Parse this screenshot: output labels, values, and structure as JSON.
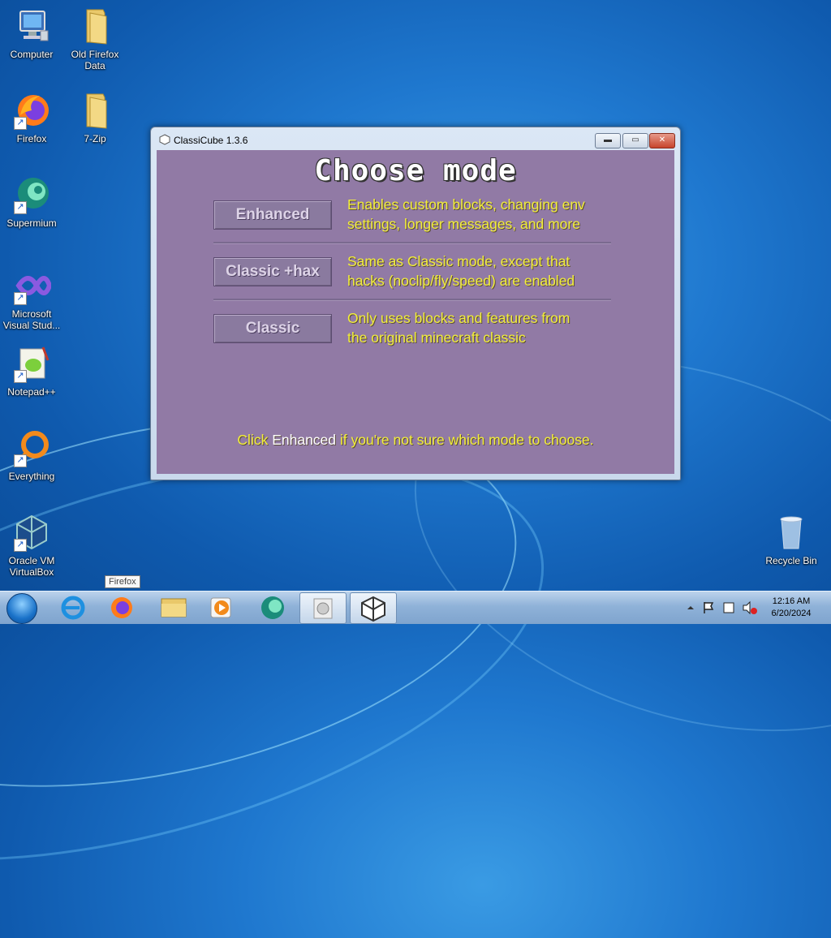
{
  "desktop": {
    "icons": [
      {
        "label": "Computer",
        "icon": "computer-icon"
      },
      {
        "label": "Old Firefox Data",
        "icon": "folder-icon"
      },
      {
        "label": "Firefox",
        "icon": "firefox-icon"
      },
      {
        "label": "7-Zip",
        "icon": "folder-icon"
      },
      {
        "label": "Supermium",
        "icon": "supermium-icon"
      },
      {
        "label": "Microsoft Visual Stud...",
        "icon": "visual-studio-icon"
      },
      {
        "label": "Notepad++",
        "icon": "notepadpp-icon"
      },
      {
        "label": "Everything",
        "icon": "everything-icon"
      },
      {
        "label": "Oracle VM VirtualBox",
        "icon": "virtualbox-icon"
      },
      {
        "label": "Recycle Bin",
        "icon": "recycle-bin-icon"
      }
    ]
  },
  "window": {
    "title": "ClassiCube 1.3.6",
    "controls": {
      "minimize": "▬",
      "maximize": "▭",
      "close": "✕"
    },
    "heading": "Choose mode",
    "modes": [
      {
        "label": "Enhanced",
        "desc_line1": "Enables custom blocks, changing env",
        "desc_line2": "settings, longer messages, and more"
      },
      {
        "label": "Classic +hax",
        "desc_line1": "Same as Classic mode, except that",
        "desc_line2": "hacks (noclip/fly/speed) are enabled"
      },
      {
        "label": "Classic",
        "desc_line1": "Only uses blocks and features from",
        "desc_line2": "the original minecraft classic"
      }
    ],
    "footer": {
      "pre": "Click ",
      "highlight": "Enhanced",
      "post": " if you're not sure which mode to choose."
    }
  },
  "tooltip": "Firefox",
  "taskbar": {
    "items": [
      "start-button",
      "internet-explorer",
      "firefox",
      "file-explorer",
      "media-player",
      "supermium",
      "disk-app",
      "classicube"
    ],
    "clock": {
      "time": "12:16 AM",
      "date": "6/20/2024"
    }
  },
  "colors": {
    "window_bg": "#917aa5",
    "text_yellow": "#f2ee3b",
    "desktop_blue": "#1f78cf"
  }
}
